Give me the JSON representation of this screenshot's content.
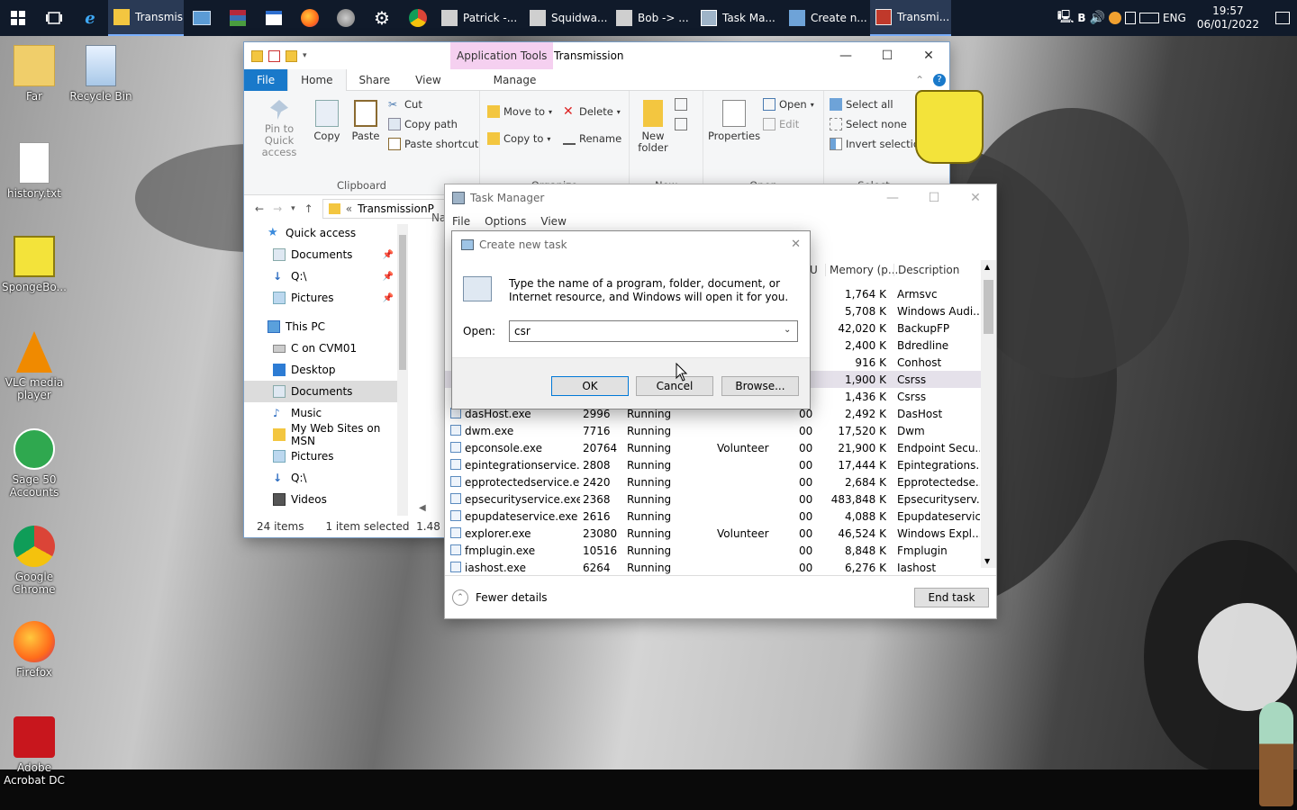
{
  "taskbar": {
    "start_icon": "windows-logo",
    "apps": [
      {
        "label": "Transmis...",
        "icon": "folder",
        "active": true
      },
      {
        "label": "",
        "icon": "control-panel"
      },
      {
        "label": "",
        "icon": "winrar"
      },
      {
        "label": "",
        "icon": "window"
      },
      {
        "label": "",
        "icon": "firefox"
      },
      {
        "label": "",
        "icon": "paint"
      },
      {
        "label": "",
        "icon": "gear"
      },
      {
        "label": "",
        "icon": "chrome"
      },
      {
        "label": "Patrick -...",
        "icon": "folder-dark"
      },
      {
        "label": "Squidwa...",
        "icon": "folder-dark"
      },
      {
        "label": "Bob -> ...",
        "icon": "folder-dark"
      },
      {
        "label": "Task Ma...",
        "icon": "task-manager"
      },
      {
        "label": "Create n...",
        "icon": "run"
      },
      {
        "label": "Transmi...",
        "icon": "transmission",
        "active": true
      }
    ],
    "tray": {
      "letter": "B",
      "language": "ENG",
      "time": "19:57",
      "date": "06/01/2022"
    }
  },
  "desktop_icons": [
    {
      "label": "Far"
    },
    {
      "label": "Recycle Bin"
    },
    {
      "label": "history.txt"
    },
    {
      "label": "SpongeBo..."
    },
    {
      "label": "VLC media player"
    },
    {
      "label": "Sage 50 Accounts"
    },
    {
      "label": "Google Chrome"
    },
    {
      "label": "Firefox"
    },
    {
      "label": "Adobe Acrobat DC"
    }
  ],
  "explorer": {
    "context_tab": "Application Tools",
    "title": "Transmission",
    "tabs": [
      "File",
      "Home",
      "Share",
      "View",
      "Manage"
    ],
    "ribbon": {
      "clipboard": {
        "label": "Clipboard",
        "pin": "Pin to Quick access",
        "copy": "Copy",
        "paste": "Paste",
        "cut": "Cut",
        "copy_path": "Copy path",
        "paste_shortcut": "Paste shortcut"
      },
      "organize": {
        "label": "Organize",
        "move_to": "Move to",
        "copy_to": "Copy to",
        "delete": "Delete",
        "rename": "Rename"
      },
      "new": {
        "label": "New",
        "new_folder": "New folder"
      },
      "open": {
        "label": "Open",
        "properties": "Properties",
        "open": "Open",
        "edit": "Edit"
      },
      "select": {
        "label": "Select",
        "select_all": "Select all",
        "select_none": "Select none",
        "invert": "Invert selection"
      }
    },
    "address": "TransmissionP",
    "nav": [
      {
        "label": "Quick access",
        "icon": "star"
      },
      {
        "label": "Documents",
        "icon": "docs",
        "pinned": true
      },
      {
        "label": "Q:\\",
        "icon": "arrow-down",
        "pinned": true
      },
      {
        "label": "Pictures",
        "icon": "pictures",
        "pinned": true
      },
      {
        "label": "This PC",
        "icon": "pc"
      },
      {
        "label": "C on CVM01",
        "icon": "drive"
      },
      {
        "label": "Desktop",
        "icon": "desktop"
      },
      {
        "label": "Documents",
        "icon": "docs",
        "selected": true
      },
      {
        "label": "Music",
        "icon": "music"
      },
      {
        "label": "My Web Sites on MSN",
        "icon": "folder"
      },
      {
        "label": "Pictures",
        "icon": "pictures"
      },
      {
        "label": "Q:\\",
        "icon": "arrow-down"
      },
      {
        "label": "Videos",
        "icon": "videos"
      }
    ],
    "column_header": "Na",
    "status": {
      "items": "24 items",
      "selected": "1 item selected",
      "size": "1.48 MB"
    }
  },
  "task_manager": {
    "title": "Task Manager",
    "menu": [
      "File",
      "Options",
      "View"
    ],
    "columns": {
      "u": "U",
      "memory": "Memory (p...",
      "description": "Description"
    },
    "rows": [
      {
        "name": "",
        "pid": "",
        "status": "",
        "user": "",
        "cpu": "",
        "memory": "1,764 K",
        "description": "Armsvc"
      },
      {
        "name": "",
        "pid": "",
        "status": "",
        "user": "",
        "cpu": "",
        "memory": "5,708 K",
        "description": "Windows Audi..."
      },
      {
        "name": "",
        "pid": "",
        "status": "",
        "user": "",
        "cpu": "",
        "memory": "42,020 K",
        "description": "BackupFP"
      },
      {
        "name": "",
        "pid": "",
        "status": "",
        "user": "",
        "cpu": "",
        "memory": "2,400 K",
        "description": "Bdredline"
      },
      {
        "name": "",
        "pid": "",
        "status": "",
        "user": "",
        "cpu": "",
        "memory": "916 K",
        "description": "Conhost"
      },
      {
        "name": "",
        "pid": "",
        "status": "",
        "user": "",
        "cpu": "",
        "memory": "1,900 K",
        "description": "Csrss",
        "highlight": true
      },
      {
        "name": "",
        "pid": "",
        "status": "",
        "user": "",
        "cpu": "",
        "memory": "1,436 K",
        "description": "Csrss"
      },
      {
        "name": "dasHost.exe",
        "pid": "2996",
        "status": "Running",
        "user": "",
        "cpu": "00",
        "memory": "2,492 K",
        "description": "DasHost"
      },
      {
        "name": "dwm.exe",
        "pid": "7716",
        "status": "Running",
        "user": "",
        "cpu": "00",
        "memory": "17,520 K",
        "description": "Dwm"
      },
      {
        "name": "epconsole.exe",
        "pid": "20764",
        "status": "Running",
        "user": "Volunteer",
        "cpu": "00",
        "memory": "21,900 K",
        "description": "Endpoint Secu..."
      },
      {
        "name": "epintegrationservice....",
        "pid": "2808",
        "status": "Running",
        "user": "",
        "cpu": "00",
        "memory": "17,444 K",
        "description": "Epintegrations..."
      },
      {
        "name": "epprotectedservice.e...",
        "pid": "2420",
        "status": "Running",
        "user": "",
        "cpu": "00",
        "memory": "2,684 K",
        "description": "Epprotectedse..."
      },
      {
        "name": "epsecurityservice.exe",
        "pid": "2368",
        "status": "Running",
        "user": "",
        "cpu": "00",
        "memory": "483,848 K",
        "description": "Epsecurityserv..."
      },
      {
        "name": "epupdateservice.exe",
        "pid": "2616",
        "status": "Running",
        "user": "",
        "cpu": "00",
        "memory": "4,088 K",
        "description": "Epupdateservice"
      },
      {
        "name": "explorer.exe",
        "pid": "23080",
        "status": "Running",
        "user": "Volunteer",
        "cpu": "00",
        "memory": "46,524 K",
        "description": "Windows Expl..."
      },
      {
        "name": "fmplugin.exe",
        "pid": "10516",
        "status": "Running",
        "user": "",
        "cpu": "00",
        "memory": "8,848 K",
        "description": "Fmplugin"
      },
      {
        "name": "iashost.exe",
        "pid": "6264",
        "status": "Running",
        "user": "",
        "cpu": "00",
        "memory": "6,276 K",
        "description": "Iashost"
      }
    ],
    "fewer_details": "Fewer details",
    "end_task": "End task"
  },
  "run_dialog": {
    "title": "Create new task",
    "message": "Type the name of a program, folder, document, or Internet resource, and Windows will open it for you.",
    "open_label": "Open:",
    "open_value": "csr",
    "ok": "OK",
    "cancel": "Cancel",
    "browse": "Browse..."
  }
}
